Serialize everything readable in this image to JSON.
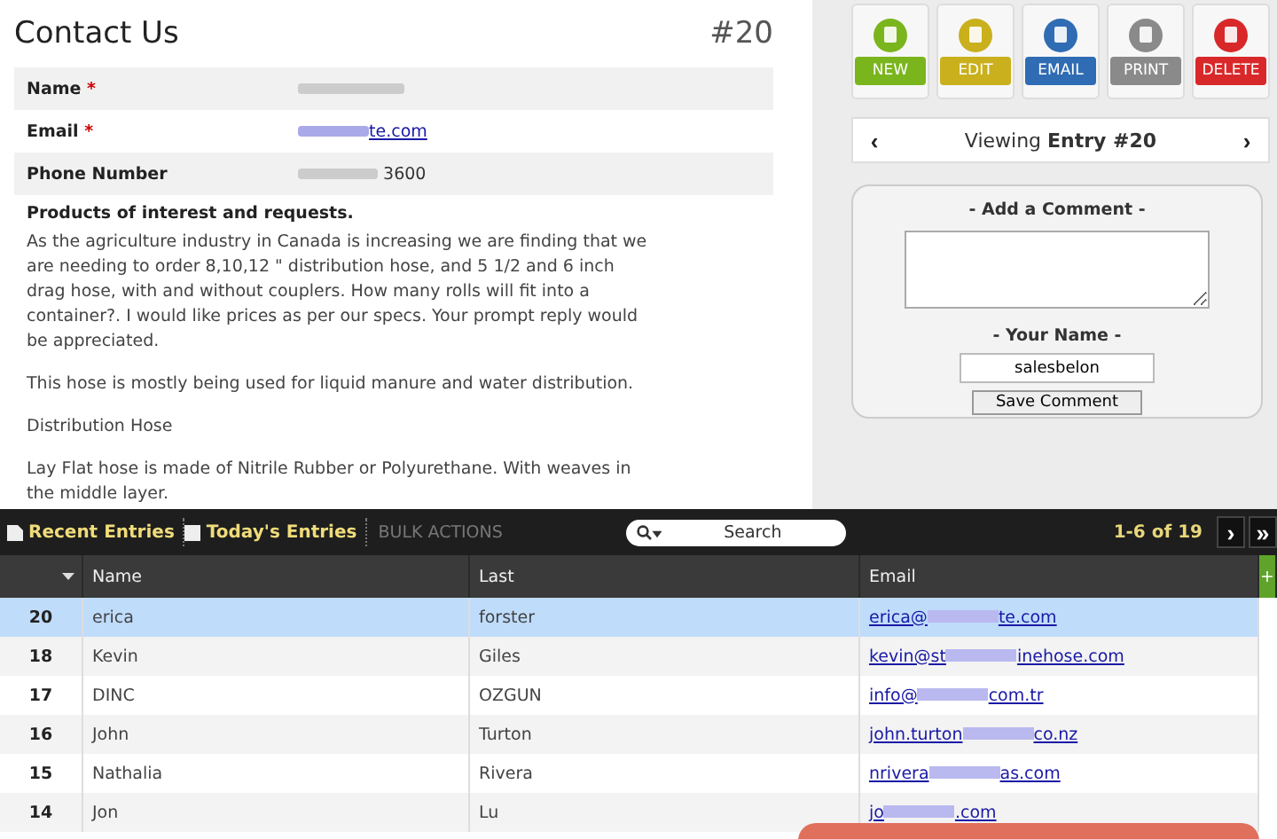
{
  "entry": {
    "title": "Contact Us",
    "number": "#20",
    "required_mark": "*",
    "fields": [
      {
        "label": "Name",
        "required": true,
        "kind": "blurred"
      },
      {
        "label": "Email",
        "required": true,
        "kind": "link",
        "value": "te.com"
      },
      {
        "label": "Phone Number",
        "required": false,
        "kind": "partial",
        "value": "3600"
      }
    ],
    "message_heading": "Products of interest and requests.",
    "paragraphs": [
      "As the agriculture industry in Canada is increasing we are finding that we are needing to order 8,10,12 \" distribution hose, and 5 1/2 and 6 inch drag hose, with and without couplers. How many rolls will fit into a container?. I would like prices as per our specs. Your prompt reply would be appreciated.",
      "This hose is mostly being used for liquid manure and water distribution.",
      "Distribution Hose",
      "Lay Flat hose is made of Nitrile Rubber or Polyurethane. With weaves in the middle layer."
    ]
  },
  "actions": [
    {
      "label": "NEW",
      "color": "#7ab51d"
    },
    {
      "label": "EDIT",
      "color": "#c9b01c"
    },
    {
      "label": "EMAIL",
      "color": "#2f6cb4"
    },
    {
      "label": "PRINT",
      "color": "#8a8a8a"
    },
    {
      "label": "DELETE",
      "color": "#d9282a"
    }
  ],
  "pager": {
    "prev": "‹",
    "text": "Viewing **Entry #20**",
    "next": "›"
  },
  "comment": {
    "heading": "- Add a Comment -",
    "name_heading": "- Your Name -",
    "name_value": "salesbelon",
    "button": "Save Comment"
  },
  "toolbar": {
    "tabs": [
      {
        "label": "Recent Entries",
        "kind": "document"
      },
      {
        "label": "Today's Entries",
        "kind": "checkbox"
      }
    ],
    "bulk": "BULK ACTIONS",
    "search_placeholder": "Search",
    "count": "1-6 of 19",
    "next": "›",
    "last": "»"
  },
  "table": {
    "columns": [
      "Name",
      "Last",
      "Email"
    ],
    "add": "+",
    "rows": [
      {
        "id": "20",
        "name": "erica",
        "last": "forster",
        "email_start": "erica@",
        "email_end": "te.com",
        "selected": true
      },
      {
        "id": "18",
        "name": "Kevin",
        "last": "Giles",
        "email_start": "kevin@st",
        "email_end": "inehose.com",
        "selected": false
      },
      {
        "id": "17",
        "name": "DINC",
        "last": "OZGUN",
        "email_start": "info@",
        "email_end": "com.tr",
        "selected": false
      },
      {
        "id": "16",
        "name": "John",
        "last": "Turton",
        "email_start": "john.turton",
        "email_end": "co.nz",
        "selected": false
      },
      {
        "id": "15",
        "name": "Nathalia",
        "last": "Rivera",
        "email_start": "nrivera",
        "email_end": "as.com",
        "selected": false
      },
      {
        "id": "14",
        "name": "Jon",
        "last": "Lu",
        "email_start": "jo",
        "email_end": ".com",
        "selected": false
      }
    ]
  }
}
